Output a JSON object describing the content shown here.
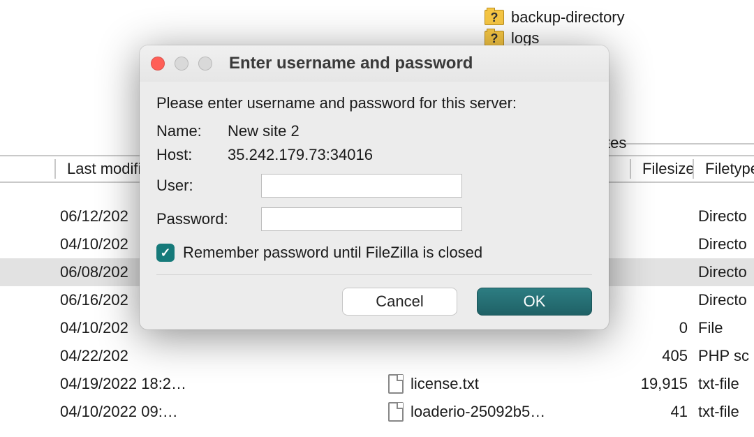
{
  "background": {
    "folders": [
      {
        "name": "backup-directory"
      },
      {
        "name": "logs"
      }
    ],
    "headers": {
      "last_modified": "Last modifi",
      "partial_tes": "tes",
      "filesize": "Filesize",
      "filetype": "Filetype"
    },
    "rows": [
      {
        "date": "06/12/202",
        "name": "",
        "size": "",
        "type": "Directo"
      },
      {
        "date": "04/10/202",
        "name": "",
        "size": "",
        "type": "Directo"
      },
      {
        "date": "06/08/202",
        "name": "",
        "size": "",
        "type": "Directo",
        "highlight": true
      },
      {
        "date": "06/16/202",
        "name": "",
        "size": "",
        "type": "Directo"
      },
      {
        "date": "04/10/202",
        "name": "",
        "size": "0",
        "type": "File"
      },
      {
        "date": "04/22/202",
        "name": "",
        "size": "405",
        "type": "PHP sc"
      },
      {
        "date": "04/19/2022 18:2…",
        "name": "license.txt",
        "size": "19,915",
        "type": "txt-file"
      },
      {
        "date": "04/10/2022 09:…",
        "name": "loaderio-25092b5…",
        "size": "41",
        "type": "txt-file"
      }
    ]
  },
  "dialog": {
    "title": "Enter username and password",
    "prompt": "Please enter username and password for this server:",
    "name_label": "Name:",
    "name_value": "New site 2",
    "host_label": "Host:",
    "host_value": "35.242.179.73:34016",
    "user_label": "User:",
    "user_value": "",
    "password_label": "Password:",
    "password_value": "",
    "remember_label": "Remember password until FileZilla is closed",
    "remember_checked": true,
    "cancel_label": "Cancel",
    "ok_label": "OK"
  }
}
